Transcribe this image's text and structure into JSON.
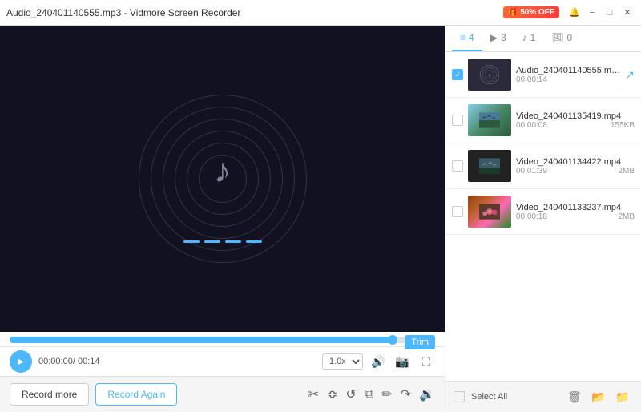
{
  "titleBar": {
    "title": "Audio_240401140555.mp3 - Vidmore Screen Recorder",
    "promo": "50% OFF",
    "minimizeLabel": "−",
    "maximizeLabel": "□",
    "closeLabel": "✕"
  },
  "tabs": [
    {
      "id": "list",
      "icon": "≡",
      "count": "4",
      "active": true
    },
    {
      "id": "video",
      "icon": "▶",
      "count": "3",
      "active": false
    },
    {
      "id": "audio",
      "icon": "♪",
      "count": "1",
      "active": false
    },
    {
      "id": "image",
      "icon": "🖼",
      "count": "0",
      "active": false
    }
  ],
  "fileList": [
    {
      "name": "Audio_240401140555.mp3",
      "duration": "00:00:14",
      "size": "",
      "type": "audio",
      "checked": true
    },
    {
      "name": "Video_240401135419.mp4",
      "duration": "00:00:08",
      "size": "155KB",
      "type": "video",
      "checked": false
    },
    {
      "name": "Video_240401134422.mp4",
      "duration": "00:01:39",
      "size": "2MB",
      "type": "video",
      "checked": false
    },
    {
      "name": "Video_240401133237.mp4",
      "duration": "00:00:18",
      "size": "2MB",
      "type": "video",
      "checked": false
    }
  ],
  "player": {
    "currentTime": "00:00:00",
    "totalTime": "00:14",
    "speed": "1.0x",
    "trimLabel": "Trim"
  },
  "actions": {
    "recordMore": "Record more",
    "recordAgain": "Record Again"
  },
  "bottomBar": {
    "selectAll": "Select All"
  },
  "editTools": [
    "✂",
    "≡",
    "↺",
    "⧉",
    "✏",
    "↷",
    "🔊"
  ]
}
